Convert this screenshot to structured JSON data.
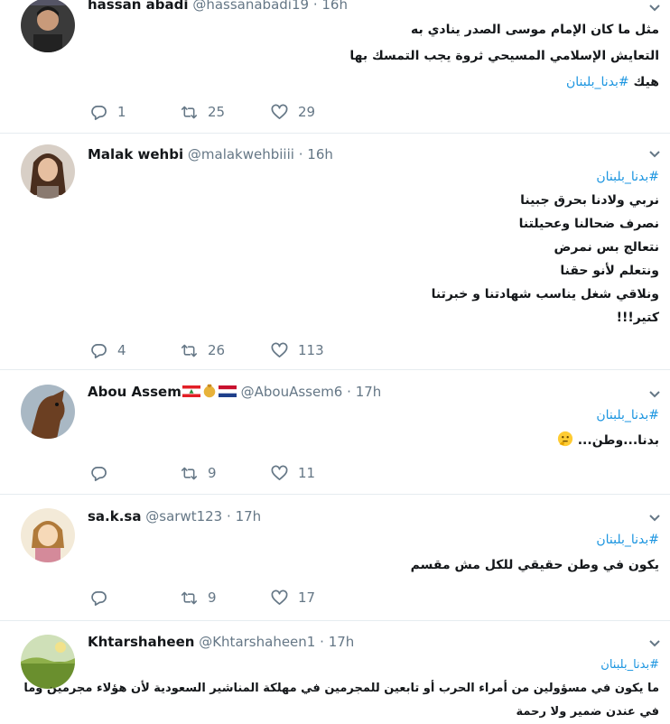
{
  "tweets": [
    {
      "name": "hassan abadi",
      "handle": "@hassanabadi19",
      "time": "16h",
      "lines": [
        "مثل ما كان الإمام موسى الصدر ينادي به",
        "التعايش الإسلامي المسيحي ثروة يجب التمسك بها"
      ],
      "last_line_text": "هيك",
      "last_line_tag": "#بدنا_بلبنان",
      "replies": "1",
      "retweets": "25",
      "likes": "29"
    },
    {
      "name": "Malak wehbi",
      "handle": "@malakwehbiiii",
      "time": "16h",
      "hashtag": "#بدنا_بلبنان",
      "lines": [
        "نربي ولادنا بحرق جبينا",
        "نصرف ضحالنا وعحيلتنا",
        "نتعالج بس نمرض",
        "ونتعلم لأنو حقنا",
        "ونلاقي شغل يناسب شهادتنا و خبرتنا",
        "كتير!!!"
      ],
      "replies": "4",
      "retweets": "26",
      "likes": "113"
    },
    {
      "name": "Abou Assem",
      "handle": "@AbouAssem6",
      "time": "17h",
      "hashtag": "#بدنا_بلبنان",
      "lines": [
        "بدنا...وطن..."
      ],
      "replies": "",
      "retweets": "9",
      "likes": "11"
    },
    {
      "name": "sa.k.sa",
      "handle": "@sarwt123",
      "time": "17h",
      "hashtag": "#بدنا_بلبنان",
      "lines": [
        "يكون في وطن حقيقي للكل مش مقسم"
      ],
      "replies": "",
      "retweets": "9",
      "likes": "17"
    },
    {
      "name": "Khtarshaheen",
      "handle": "@Khtarshaheen1",
      "time": "17h",
      "hashtag": "#بدنا_بلبنان",
      "lines": [
        "ما يكون في مسؤولين من أمراء الحرب أو تابعين للمجرمين في مهلكة المناشير السعودية لأن هؤلاء مجرمين وما",
        "في عندن ضمير ولا رحمة"
      ]
    }
  ],
  "colors": {
    "text": "#14171a",
    "secondary": "#657786",
    "hashtag": "#1b95e0",
    "divider": "#e6ecf0"
  },
  "icons": [
    "reply-icon",
    "retweet-icon",
    "like-icon",
    "caret-down-icon",
    "thinking-face-icon",
    "lebanon-flag-icon",
    "netherlands-flag-icon"
  ]
}
